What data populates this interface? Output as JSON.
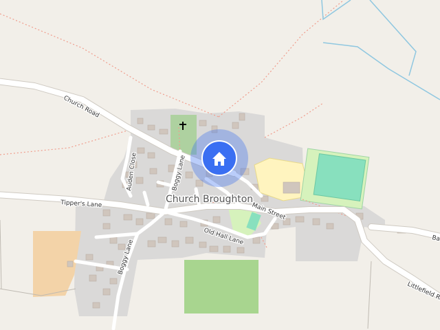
{
  "map": {
    "place_name": "Church Broughton",
    "roads": {
      "church_road": "Church Road",
      "tippers_lane": "Tipper's Lane",
      "auden_close": "Auden Close",
      "boggy_lane_north": "Boggy Lane",
      "boggy_lane_south": "Boggy Lane",
      "main_street": "Main Street",
      "old_hall_lane": "Old Hall Lane",
      "littlefield_road": "Littlefield Ro",
      "east_road_cut": "Ba"
    },
    "marker": {
      "icon": "home-icon",
      "color": "#3a6ff2"
    },
    "colors": {
      "background": "#f2efe9",
      "residential": "#dad9d8",
      "road": "#ffffff",
      "footpath": "#f09c8c",
      "water": "#8fc7e0",
      "park": "#d6f2bc",
      "pitch": "#88e0be",
      "farmland": "#a8d58f",
      "school": "#fff4bf",
      "cemetery": "#aed1a0",
      "allotment": "#f3d3a8"
    }
  }
}
